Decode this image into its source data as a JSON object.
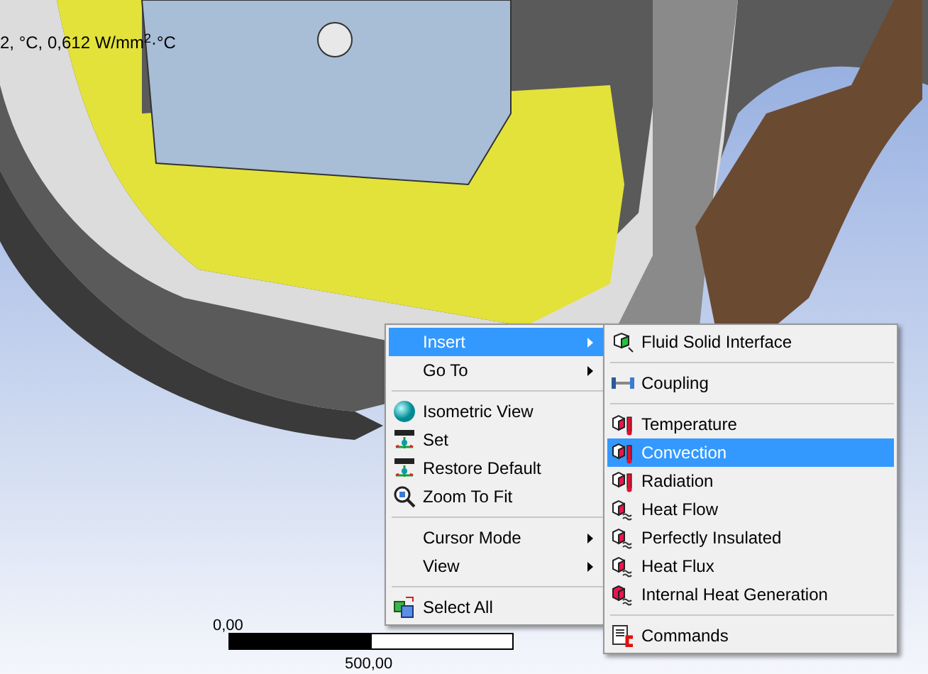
{
  "legend_text": "2, °C, 0,612 W/mm$^{2}$·°C",
  "scale_bar": {
    "start_label": "0,00",
    "mid_label": "500,00"
  },
  "context_menu": {
    "items": [
      {
        "kind": "item",
        "label": "Insert",
        "submenu": true,
        "selected": true
      },
      {
        "kind": "item",
        "label": "Go To",
        "submenu": true,
        "selected": false
      },
      {
        "kind": "separator"
      },
      {
        "kind": "item",
        "label": "Isometric View",
        "submenu": false,
        "selected": false
      },
      {
        "kind": "item",
        "label": "Set",
        "submenu": false,
        "selected": false
      },
      {
        "kind": "item",
        "label": "Restore Default",
        "submenu": false,
        "selected": false
      },
      {
        "kind": "item",
        "label": "Zoom To Fit",
        "submenu": false,
        "selected": false
      },
      {
        "kind": "separator"
      },
      {
        "kind": "item",
        "label": "Cursor Mode",
        "submenu": true,
        "selected": false
      },
      {
        "kind": "item",
        "label": "View",
        "submenu": true,
        "selected": false
      },
      {
        "kind": "separator"
      },
      {
        "kind": "item",
        "label": "Select All",
        "submenu": false,
        "selected": false
      }
    ]
  },
  "insert_submenu": {
    "items": [
      {
        "kind": "item",
        "label": "Fluid Solid Interface",
        "selected": false
      },
      {
        "kind": "separator"
      },
      {
        "kind": "item",
        "label": "Coupling",
        "selected": false
      },
      {
        "kind": "separator"
      },
      {
        "kind": "item",
        "label": "Temperature",
        "selected": false
      },
      {
        "kind": "item",
        "label": "Convection",
        "selected": true
      },
      {
        "kind": "item",
        "label": "Radiation",
        "selected": false
      },
      {
        "kind": "item",
        "label": "Heat Flow",
        "selected": false
      },
      {
        "kind": "item",
        "label": "Perfectly Insulated",
        "selected": false
      },
      {
        "kind": "item",
        "label": "Heat Flux",
        "selected": false
      },
      {
        "kind": "item",
        "label": "Internal Heat Generation",
        "selected": false
      },
      {
        "kind": "separator"
      },
      {
        "kind": "item",
        "label": "Commands",
        "selected": false
      }
    ]
  }
}
